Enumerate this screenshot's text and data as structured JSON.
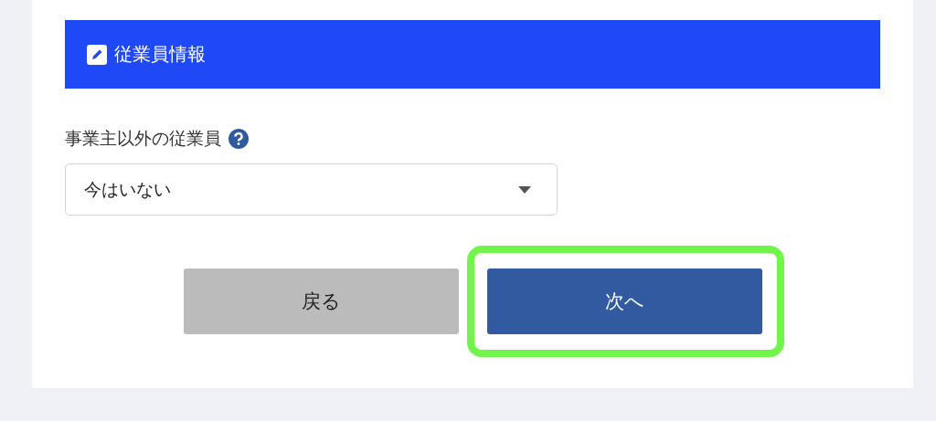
{
  "section": {
    "title": "従業員情報"
  },
  "field": {
    "label": "事業主以外の従業員",
    "value": "今はいない"
  },
  "buttons": [
    {
      "label": "戻る",
      "kind": "secondary",
      "highlighted": false
    },
    {
      "label": "次へ",
      "kind": "primary",
      "highlighted": true
    }
  ]
}
